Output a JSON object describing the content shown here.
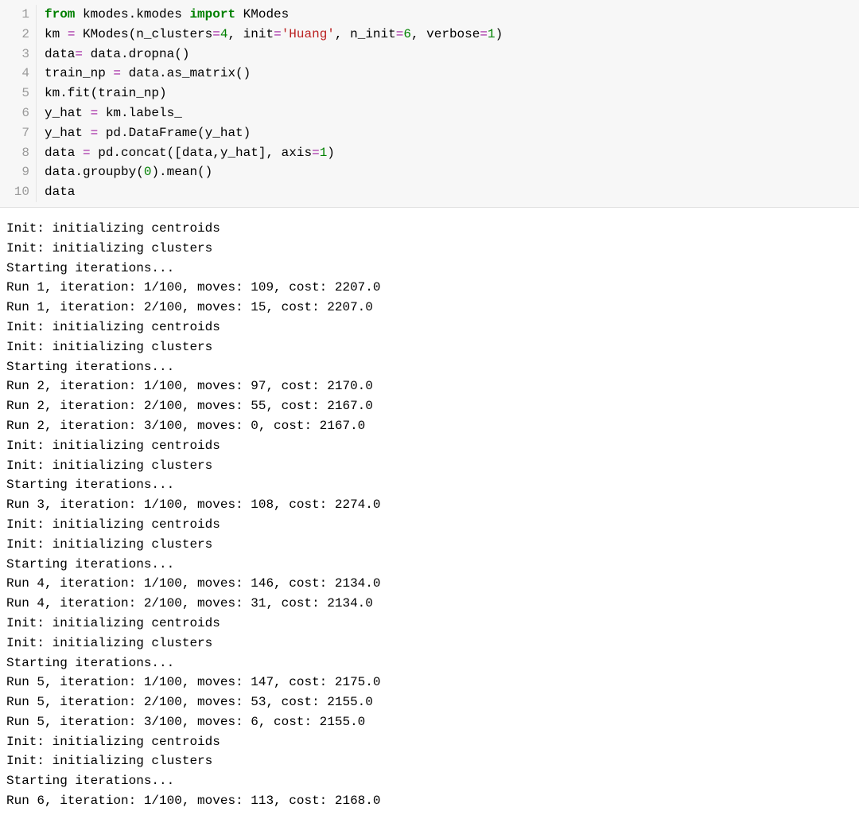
{
  "code": {
    "lines": [
      [
        {
          "t": "from",
          "c": "keyword"
        },
        {
          "t": " kmodes.kmodes ",
          "c": "name"
        },
        {
          "t": "import",
          "c": "keyword"
        },
        {
          "t": " KModes",
          "c": "name"
        }
      ],
      [
        {
          "t": "km ",
          "c": "name"
        },
        {
          "t": "=",
          "c": "operator"
        },
        {
          "t": " KModes(n_clusters",
          "c": "name"
        },
        {
          "t": "=",
          "c": "operator"
        },
        {
          "t": "4",
          "c": "number"
        },
        {
          "t": ", init",
          "c": "name"
        },
        {
          "t": "=",
          "c": "operator"
        },
        {
          "t": "'Huang'",
          "c": "string"
        },
        {
          "t": ", n_init",
          "c": "name"
        },
        {
          "t": "=",
          "c": "operator"
        },
        {
          "t": "6",
          "c": "number"
        },
        {
          "t": ", verbose",
          "c": "name"
        },
        {
          "t": "=",
          "c": "operator"
        },
        {
          "t": "1",
          "c": "number"
        },
        {
          "t": ")",
          "c": "name"
        }
      ],
      [
        {
          "t": "data",
          "c": "name"
        },
        {
          "t": "=",
          "c": "operator"
        },
        {
          "t": " data.dropna()",
          "c": "name"
        }
      ],
      [
        {
          "t": "train_np ",
          "c": "name"
        },
        {
          "t": "=",
          "c": "operator"
        },
        {
          "t": " data.as_matrix()",
          "c": "name"
        }
      ],
      [
        {
          "t": "km.fit(train_np)",
          "c": "name"
        }
      ],
      [
        {
          "t": "y_hat ",
          "c": "name"
        },
        {
          "t": "=",
          "c": "operator"
        },
        {
          "t": " km.labels_",
          "c": "name"
        }
      ],
      [
        {
          "t": "y_hat ",
          "c": "name"
        },
        {
          "t": "=",
          "c": "operator"
        },
        {
          "t": " pd.DataFrame(y_hat)",
          "c": "name"
        }
      ],
      [
        {
          "t": "data ",
          "c": "name"
        },
        {
          "t": "=",
          "c": "operator"
        },
        {
          "t": " pd.concat([data,y_hat], axis",
          "c": "name"
        },
        {
          "t": "=",
          "c": "operator"
        },
        {
          "t": "1",
          "c": "number"
        },
        {
          "t": ")",
          "c": "name"
        }
      ],
      [
        {
          "t": "data.groupby(",
          "c": "name"
        },
        {
          "t": "0",
          "c": "number"
        },
        {
          "t": ").mean()",
          "c": "name"
        }
      ],
      [
        {
          "t": "data",
          "c": "name"
        }
      ]
    ]
  },
  "output": {
    "lines": [
      "Init: initializing centroids",
      "Init: initializing clusters",
      "Starting iterations...",
      "Run 1, iteration: 1/100, moves: 109, cost: 2207.0",
      "Run 1, iteration: 2/100, moves: 15, cost: 2207.0",
      "Init: initializing centroids",
      "Init: initializing clusters",
      "Starting iterations...",
      "Run 2, iteration: 1/100, moves: 97, cost: 2170.0",
      "Run 2, iteration: 2/100, moves: 55, cost: 2167.0",
      "Run 2, iteration: 3/100, moves: 0, cost: 2167.0",
      "Init: initializing centroids",
      "Init: initializing clusters",
      "Starting iterations...",
      "Run 3, iteration: 1/100, moves: 108, cost: 2274.0",
      "Init: initializing centroids",
      "Init: initializing clusters",
      "Starting iterations...",
      "Run 4, iteration: 1/100, moves: 146, cost: 2134.0",
      "Run 4, iteration: 2/100, moves: 31, cost: 2134.0",
      "Init: initializing centroids",
      "Init: initializing clusters",
      "Starting iterations...",
      "Run 5, iteration: 1/100, moves: 147, cost: 2175.0",
      "Run 5, iteration: 2/100, moves: 53, cost: 2155.0",
      "Run 5, iteration: 3/100, moves: 6, cost: 2155.0",
      "Init: initializing centroids",
      "Init: initializing clusters",
      "Starting iterations...",
      "Run 6, iteration: 1/100, moves: 113, cost: 2168.0"
    ]
  }
}
